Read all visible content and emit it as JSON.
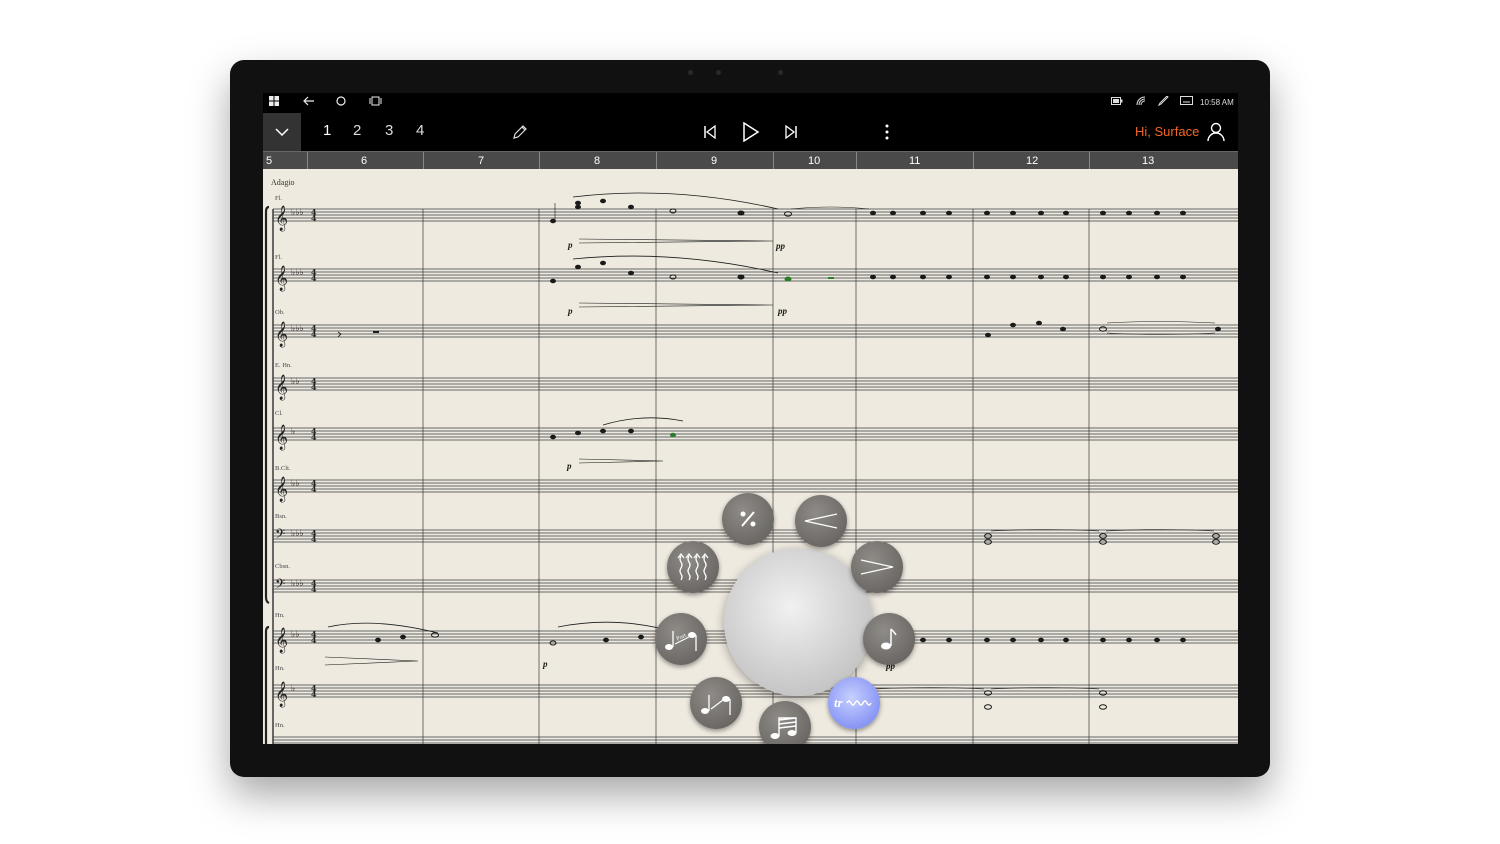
{
  "taskbar": {
    "time": "10:58 AM"
  },
  "appbar": {
    "pages": [
      "1",
      "2",
      "3",
      "4"
    ],
    "active_page": "1",
    "greeting": "Hi, Surface",
    "accent_color": "#f26722"
  },
  "ruler": {
    "measures": [
      "5",
      "6",
      "7",
      "8",
      "9",
      "10",
      "11",
      "12",
      "13"
    ]
  },
  "score": {
    "tempo": "Adagio",
    "instruments": [
      "Fl.",
      "Fl.",
      "Ob.",
      "E. Hn.",
      "Cl.",
      "B.Clt.",
      "Bsn.",
      "Cbsn.",
      "Hn.",
      "Hn.",
      "Hn."
    ],
    "dynamics": [
      "p",
      "pp",
      "p",
      "pp",
      "p",
      "p",
      "p",
      "pp",
      "pp"
    ]
  },
  "radial_menu": {
    "items": [
      "percent-articulation",
      "crescendo",
      "decrescendo",
      "single-note",
      "trill",
      "tremolo",
      "glissando",
      "portamento",
      "arpeggio"
    ],
    "selected": "trill",
    "trill_label": "tr",
    "portamento_label": "Port."
  }
}
